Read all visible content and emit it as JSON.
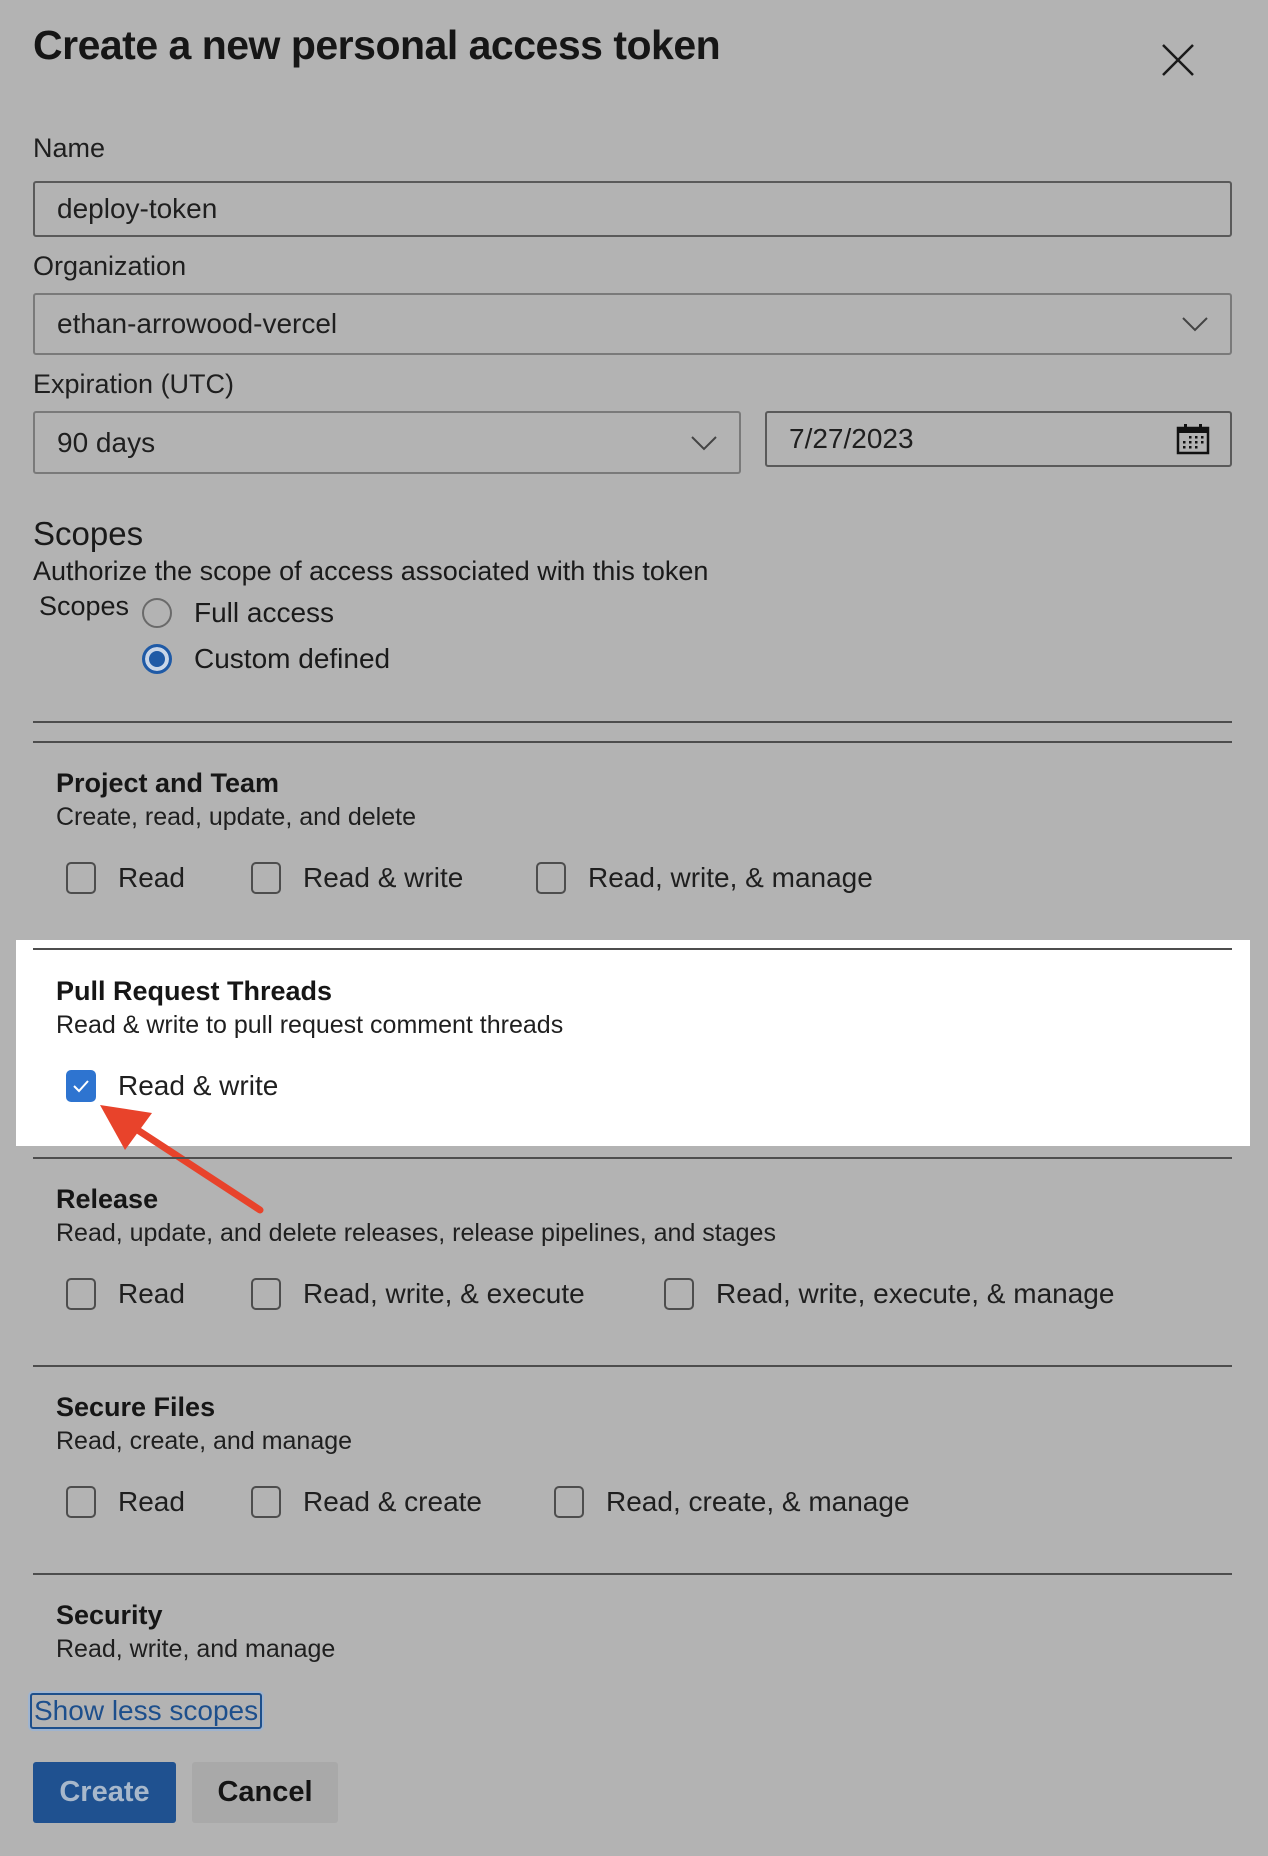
{
  "dialog": {
    "title": "Create a new personal access token",
    "close_icon": "close-icon"
  },
  "form": {
    "name_label": "Name",
    "name_value": "deploy-token",
    "organization_label": "Organization",
    "organization_value": "ethan-arrowood-vercel",
    "expiration_label": "Expiration (UTC)",
    "expiration_value": "90 days",
    "expiration_date": "7/27/2023"
  },
  "scopes": {
    "heading": "Scopes",
    "description": "Authorize the scope of access associated with this token",
    "radio_group_label": "Scopes",
    "options": [
      {
        "label": "Full access",
        "selected": false
      },
      {
        "label": "Custom defined",
        "selected": true
      }
    ]
  },
  "sections": [
    {
      "title": "Project and Team",
      "description": "Create, read, update, and delete",
      "checkboxes": [
        {
          "label": "Read",
          "checked": false
        },
        {
          "label": "Read & write",
          "checked": false
        },
        {
          "label": "Read, write, & manage",
          "checked": false
        }
      ]
    },
    {
      "title": "Pull Request Threads",
      "description": "Read & write to pull request comment threads",
      "highlighted": true,
      "checkboxes": [
        {
          "label": "Read & write",
          "checked": true
        }
      ]
    },
    {
      "title": "Release",
      "description": "Read, update, and delete releases, release pipelines, and stages",
      "checkboxes": [
        {
          "label": "Read",
          "checked": false
        },
        {
          "label": "Read, write, & execute",
          "checked": false
        },
        {
          "label": "Read, write, execute, & manage",
          "checked": false
        }
      ]
    },
    {
      "title": "Secure Files",
      "description": "Read, create, and manage",
      "checkboxes": [
        {
          "label": "Read",
          "checked": false
        },
        {
          "label": "Read & create",
          "checked": false
        },
        {
          "label": "Read, create, & manage",
          "checked": false
        }
      ]
    },
    {
      "title": "Security",
      "description": "Read, write, and manage",
      "checkboxes": []
    }
  ],
  "footer": {
    "toggle_link": "Show less scopes",
    "create_label": "Create",
    "cancel_label": "Cancel"
  },
  "colors": {
    "accent": "#1f5190",
    "checkbox_checked": "#2e74d0",
    "annotation_arrow": "#e8432b"
  }
}
